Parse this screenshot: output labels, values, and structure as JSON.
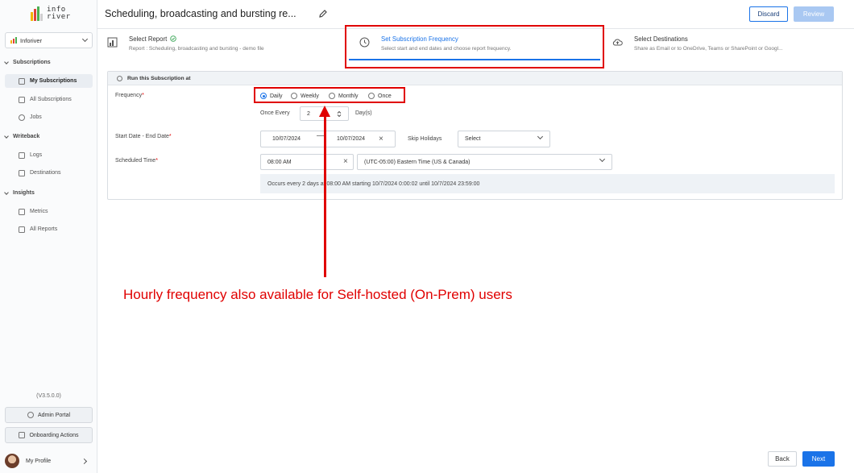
{
  "logo": {
    "line1": "info",
    "line2": "river"
  },
  "workspace": {
    "name": "Inforiver"
  },
  "sidebar": {
    "sections": [
      {
        "label": "Subscriptions",
        "items": [
          "My Subscriptions",
          "All Subscriptions",
          "Jobs"
        ]
      },
      {
        "label": "Writeback",
        "items": [
          "Logs",
          "Destinations"
        ]
      },
      {
        "label": "Insights",
        "items": [
          "Metrics",
          "All Reports"
        ]
      }
    ],
    "version": "(V3.5.0.0)",
    "admin_portal": "Admin Portal",
    "onboarding": "Onboarding Actions",
    "profile": "My Profile"
  },
  "header": {
    "title": "Scheduling, broadcasting and bursting re...",
    "discard": "Discard",
    "review": "Review"
  },
  "steps": [
    {
      "title": "Select Report",
      "subtitle": "Report : Scheduling, broadcasting and bursting - demo file"
    },
    {
      "title": "Set Subscription Frequency",
      "subtitle": "Select start and end dates and choose report frequency."
    },
    {
      "title": "Select Destinations",
      "subtitle": "Share as Email or to OneDrive, Teams or SharePoint or Googl..."
    }
  ],
  "form": {
    "panel_title": "Run this Subscription at",
    "frequency_label": "Frequency",
    "frequency_options": [
      "Daily",
      "Weekly",
      "Monthly",
      "Once"
    ],
    "frequency_selected": "Daily",
    "once_every_label": "Once Every",
    "once_every_value": "2",
    "once_every_unit": "Day(s)",
    "date_label": "Start Date - End Date",
    "start_date": "10/07/2024",
    "end_date": "10/07/2024",
    "skip_holidays_label": "Skip Holidays",
    "skip_holidays_value": "Select",
    "time_label": "Scheduled Time",
    "time_value": "08:00 AM",
    "timezone": "(UTC-05:00) Eastern Time (US & Canada)",
    "summary": "Occurs every 2 days at 08:00 AM starting 10/7/2024 0:00:02 until 10/7/2024 23:59:00"
  },
  "annotation": "Hourly frequency also available for Self-hosted (On-Prem) users",
  "footer": {
    "back": "Back",
    "next": "Next"
  },
  "colors": {
    "accent": "#1a73e8",
    "annotation": "#e00000"
  }
}
